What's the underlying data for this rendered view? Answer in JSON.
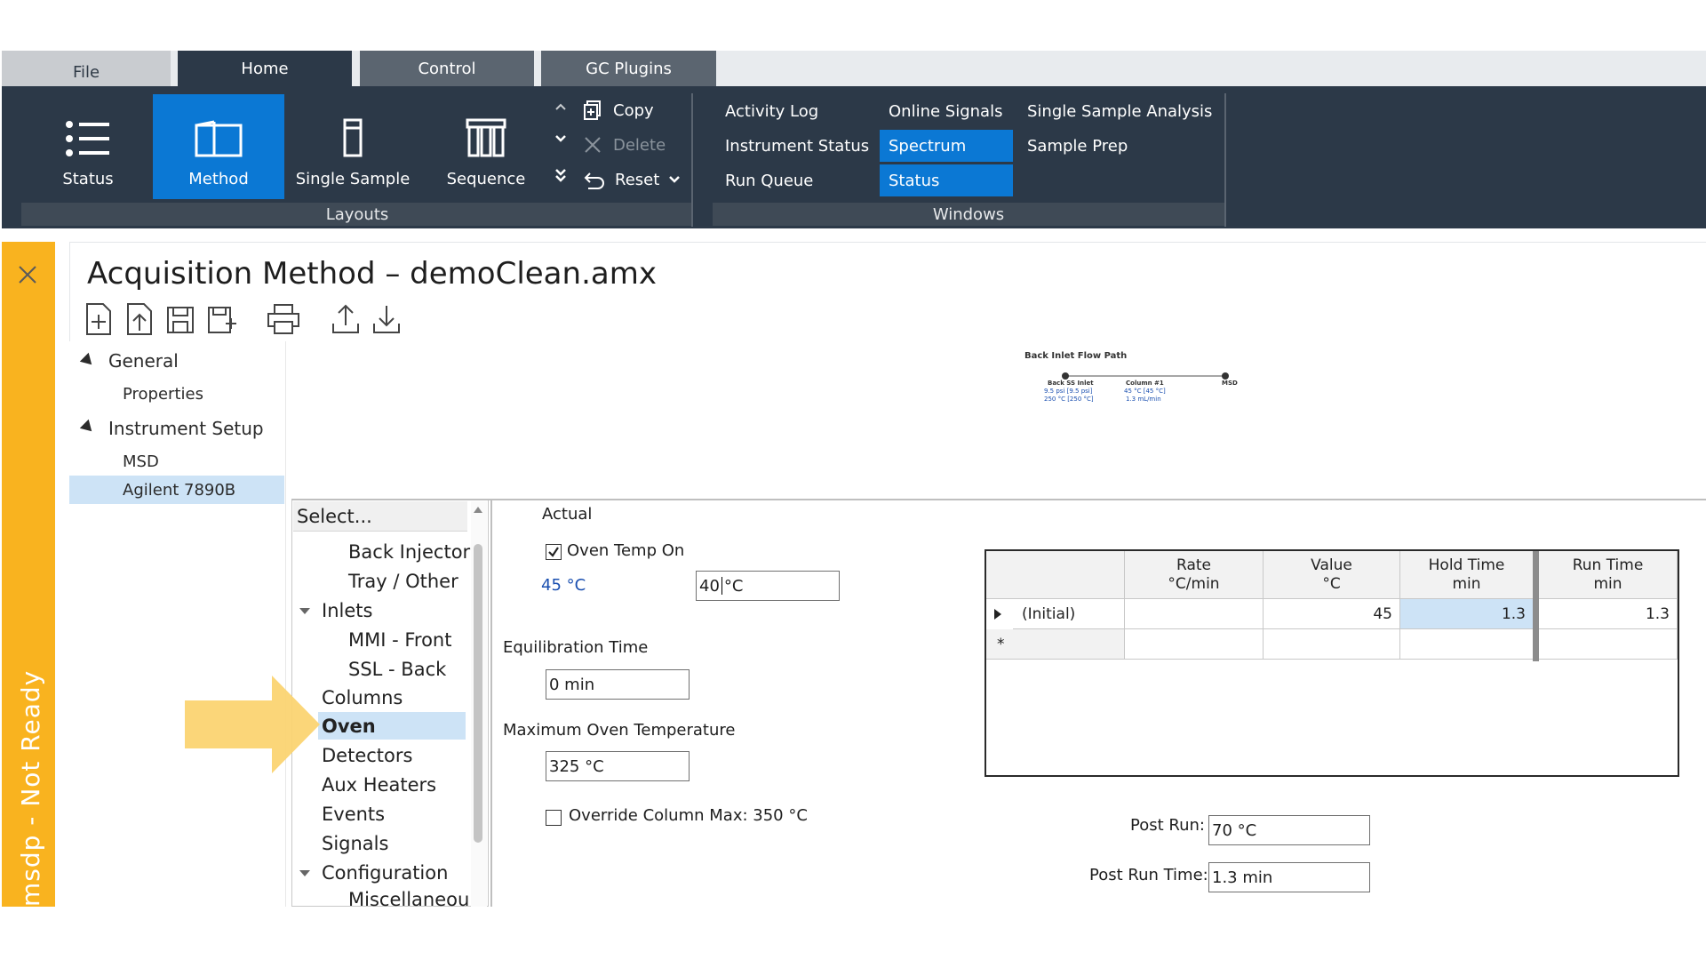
{
  "tabs": {
    "file": "File",
    "home": "Home",
    "control": "Control",
    "gc_plugins": "GC Plugins"
  },
  "ribbon": {
    "layouts": {
      "status": "Status",
      "method": "Method",
      "single_sample": "Single Sample",
      "sequence": "Sequence",
      "group_label": "Layouts"
    },
    "edit": {
      "copy": "Copy",
      "delete": "Delete",
      "reset": "Reset"
    },
    "windows": {
      "activity_log": "Activity Log",
      "instrument_status": "Instrument Status",
      "run_queue": "Run Queue",
      "online_signals": "Online Signals",
      "spectrum": "Spectrum",
      "status": "Status",
      "single_sample_analysis": "Single Sample Analysis",
      "sample_prep": "Sample Prep",
      "group_label": "Windows"
    }
  },
  "status_strip": {
    "text": "msdp - Not Ready"
  },
  "page": {
    "title": "Acquisition Method – demoClean.amx"
  },
  "nav": {
    "general": "General",
    "properties": "Properties",
    "instrument_setup": "Instrument Setup",
    "msd": "MSD",
    "agilent": "Agilent 7890B"
  },
  "flow_path": {
    "title": "Back Inlet Flow Path",
    "inlet_name": "Back SS Inlet",
    "inlet_line1": "9.5 psi [9.5 psi]",
    "inlet_line2": "250 °C [250 °C]",
    "column_name": "Column #1",
    "column_line1": "45 °C [45 °C]",
    "column_line2": "1.3 mL/min",
    "detector": "MSD"
  },
  "tree": {
    "header": "Select...",
    "items": [
      "Back Injector",
      "Tray / Other",
      "Inlets",
      "MMI - Front",
      "SSL - Back",
      "Columns",
      "Oven",
      "Detectors",
      "Aux Heaters",
      "Events",
      "Signals",
      "Configuration",
      "Miscellaneou"
    ]
  },
  "oven": {
    "actual_label": "Actual",
    "oven_temp_on": "Oven Temp On",
    "actual_value": "45 °C",
    "setpoint_value": "40",
    "setpoint_unit": "°C",
    "equil_label": "Equilibration Time",
    "equil_value": "0 min",
    "max_label": "Maximum Oven Temperature",
    "max_value": "325 °C",
    "override_label": "Override Column Max: 350 °C",
    "post_run_label": "Post Run:",
    "post_run_value": "70 °C",
    "post_run_time_label": "Post Run Time:",
    "post_run_time_value": "1.3 min"
  },
  "ramp_table": {
    "headers": [
      {
        "line1": "Rate",
        "line2": "°C/min"
      },
      {
        "line1": "Value",
        "line2": "°C"
      },
      {
        "line1": "Hold Time",
        "line2": "min"
      },
      {
        "line1": "Run Time",
        "line2": "min"
      }
    ],
    "rows": [
      {
        "label": "(Initial)",
        "rate": "",
        "value": "45",
        "hold": "1.3",
        "run": "1.3"
      },
      {
        "label": "*",
        "rate": "",
        "value": "",
        "hold": "",
        "run": ""
      }
    ]
  },
  "colors": {
    "ribbon": "#2c3948",
    "accent": "#0b78d4",
    "status_strip": "#f9b31f",
    "selection": "#cde3f6"
  }
}
